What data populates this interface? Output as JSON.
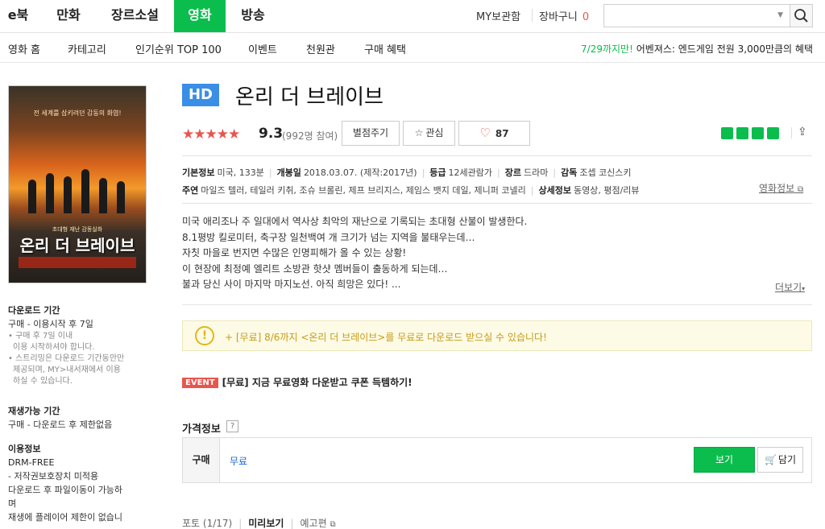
{
  "topnav": {
    "tabs": [
      "e북",
      "만화",
      "장르소설",
      "영화",
      "방송"
    ],
    "active_tab": "영화",
    "my_library": "MY보관함",
    "cart": "장바구니",
    "cart_count": "0"
  },
  "subnav": {
    "items": [
      "영화 홈",
      "카테고리",
      "인기순위 TOP 100",
      "이벤트",
      "천원관",
      "구매 혜택"
    ],
    "promo_date": "7/29까지만!",
    "promo_text": " 어벤져스: 엔드게임 전원 3,000만큼의 혜택"
  },
  "poster": {
    "tagline": "전 세계를 삼키려던 감동의 화염!",
    "subtitle": "초대형 재난 감동실화",
    "title": "온리 더 브레이브"
  },
  "left": {
    "download_h": "다운로드 기간",
    "download_v": "구매 - 이용시작 후 7일",
    "download_notes": [
      "• 구매 후 7일 이내",
      "  이용 시작하셔야 합니다.",
      "• 스트리밍은 다운로드 기간동안만",
      "  제공되며, MY>내서재에서 이용",
      "  하실 수 있습니다."
    ],
    "replay_h": "재생가능 기간",
    "replay_v": "구매 - 다운로드 후 제한없음",
    "usage_h": "이용정보",
    "usage_drm": "DRM-FREE",
    "usage_lines": [
      "- 저작권보호장치 미적용",
      "다운로드 후 파일이동이 가능하",
      "며",
      "재생에 플레이어 제한이 없습니"
    ]
  },
  "movie": {
    "badge": "HD",
    "title": "온리 더 브레이브",
    "stars": "★★★★★",
    "rating": "9.3",
    "rating_count": "(992명 참여)",
    "rate_button": "별점주기",
    "interest_button": "관심",
    "like_count": "87"
  },
  "info": {
    "basic_label": "기본정보",
    "basic_value": "미국, 133분",
    "release_label": "개봉일",
    "release_value": "2018.03.07. (제작:2017년)",
    "grade_label": "등급",
    "grade_value": "12세관람가",
    "genre_label": "장르",
    "genre_value": "드라마",
    "director_label": "감독",
    "director_value": "조셉 코신스키",
    "cast_label": "주연",
    "cast_value": "마일즈 텔러, 테일러 키취, 조슈 브롤린, 제프 브리지스, 제임스 뱃지 데일, 제니퍼 코넬리",
    "detail_label": "상세정보",
    "detail_value": "동영상, 평점/리뷰",
    "movie_info_link": "영화정보"
  },
  "synopsis": [
    "미국 애리조나 주 일대에서 역사상 최악의 재난으로 기록되는 초대형 산불이 발생한다.",
    "8.1평방 킬로미터, 축구장 일천백여 개 크기가 넘는 지역을 불태우는데…",
    "자칫 마을로 번지면 수많은 인명피해가 올 수 있는 상황!",
    "이 현장에 최정예 엘리트 소방관 핫샷 멤버들이 출동하게 되는데…",
    "불과 당신 사이 마지막 마지노선. 아직 희망은 있다! ..."
  ],
  "more_link": "더보기",
  "notice": "+ [무료] 8/6까지 <온리 더 브레이브>를 무료로 다운로드 받으실 수 있습니다!",
  "event": {
    "tag": "EVENT",
    "text": "[무료] 지금 무료영화 다운받고 쿠폰 득템하기!"
  },
  "price": {
    "heading": "가격정보",
    "help": "?",
    "buy_label": "구매",
    "buy_value": "무료",
    "view_button": "보기",
    "cart_button": "담기"
  },
  "bottom_tabs": {
    "photos": "포토 (1/17)",
    "preview": "미리보기",
    "trailer": "예고편"
  },
  "colors": {
    "accent": "#0bbd4c",
    "rating_red": "#e8554e",
    "hd_blue": "#3a8ee6"
  }
}
